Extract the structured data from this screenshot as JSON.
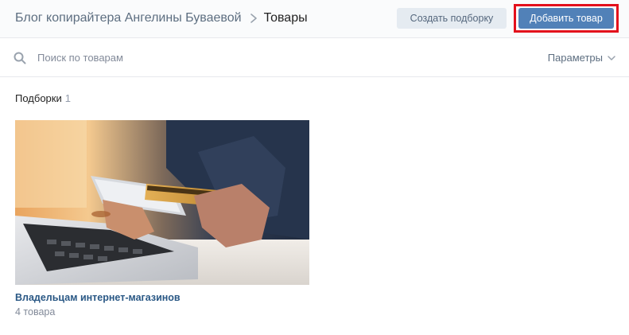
{
  "header": {
    "breadcrumb_parent": "Блог копирайтера Ангелины Буваевой",
    "breadcrumb_current": "Товары",
    "create_collection_label": "Создать подборку",
    "add_product_label": "Добавить товар"
  },
  "search": {
    "placeholder": "Поиск по товарам",
    "value": "",
    "params_label": "Параметры"
  },
  "collections": {
    "title": "Подборки",
    "count": "1",
    "items": [
      {
        "name": "Владельцам интернет-магазинов",
        "subtitle": "4 товара"
      }
    ]
  },
  "colors": {
    "primary_button": "#5181b8",
    "highlight": "#e3101c",
    "link": "#2a5885"
  },
  "icons": {
    "search": "search-icon",
    "breadcrumb_separator": "chevron-right-icon",
    "params": "chevron-down-icon"
  }
}
